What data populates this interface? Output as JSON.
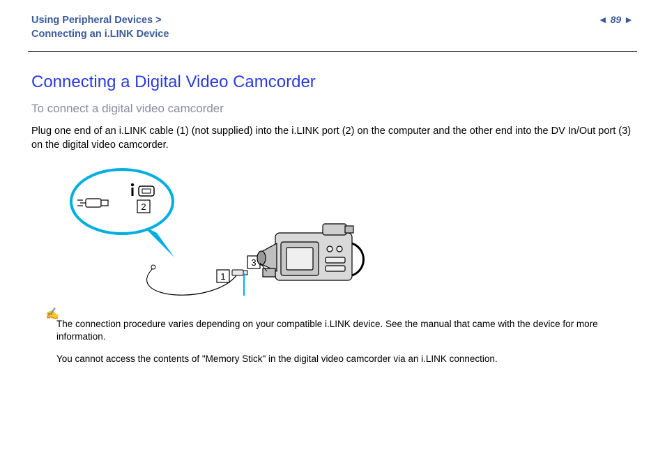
{
  "header": {
    "breadcrumb_line1": "Using Peripheral Devices",
    "breadcrumb_line2": "Connecting an i.LINK Device",
    "page_number": "89"
  },
  "main": {
    "title": "Connecting a Digital Video Camcorder",
    "subtitle": "To connect a digital video camcorder",
    "body": "Plug one end of an i.LINK cable (1) (not supplied) into the i.LINK port (2) on the computer and the other end into the DV In/Out port (3) on the digital video camcorder.",
    "callouts": {
      "c1": "1",
      "c2": "2",
      "c3": "3"
    },
    "note1": "The connection procedure varies depending on your compatible i.LINK device. See the manual that came with the device for more information.",
    "note2": "You cannot access the contents of \"Memory Stick\" in the digital video camcorder via an i.LINK connection."
  }
}
